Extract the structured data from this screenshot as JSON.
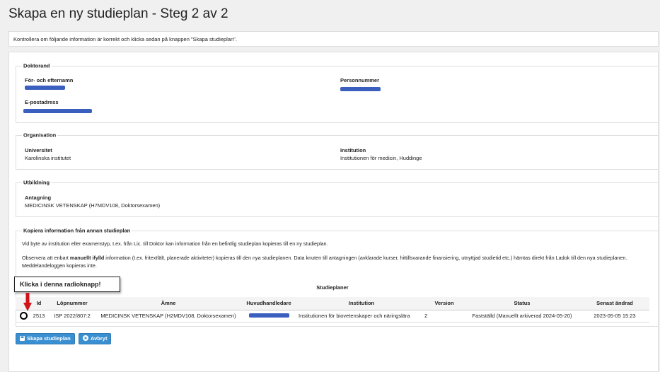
{
  "page": {
    "title": "Skapa en ny studieplan - Steg 2 av 2"
  },
  "notice": "Kontrollera om följande information är korrekt och klicka sedan på knappen \"Skapa studieplan\".",
  "doktorand": {
    "legend": "Doktorand",
    "name_label": "För- och efternamn",
    "pnr_label": "Personnummer",
    "email_label": "E-postadress"
  },
  "organisation": {
    "legend": "Organisation",
    "uni_label": "Universitet",
    "uni_value": "Karolinska institutet",
    "inst_label": "Institution",
    "inst_value": "Institutionen för medicin, Huddinge"
  },
  "utbildning": {
    "legend": "Utbildning",
    "antagning_label": "Antagning",
    "antagning_value": "MEDICINSK VETENSKAP (H7MDV108, Doktorsexamen)"
  },
  "kopiera": {
    "legend": "Kopiera information från annan studieplan",
    "para1": "Vid byte av institution eller examenstyp, t.ex. från Lic. till Doktor kan information från en befintlig studieplan kopieras till en ny studieplan.",
    "para2_pre": "Observera att enbart ",
    "para2_bold": "manuellt ifylld",
    "para2_post": " information (t.ex. fritextfält, planerade aktiviteter) kopieras till den nya studieplanen. Data knuten till antagningen (avklarade kurser, hittillsvarande finansiering, utnyttjad studietid etc.) hämtas direkt från Ladok till den nya studieplanen. Meddelandeloggen kopieras inte."
  },
  "table": {
    "caption": "Studieplaner",
    "headers": [
      "",
      "Id",
      "Löpnummer",
      "Ämne",
      "Huvudhandledare",
      "Institution",
      "Version",
      "Status",
      "Senast ändrad"
    ],
    "row": {
      "id": "2513",
      "lopnummer": "ISP 2022/807:2",
      "amne": "MEDICINSK VETENSKAP (H2MDV108, Doktorsexamen)",
      "institution": "Institutionen för biovetenskaper och näringslära",
      "version": "2",
      "status": "Fastställd (Manuellt arkiverad 2024-05-20)",
      "senast": "2023-05-05 15:23"
    }
  },
  "callout": "Klicka i denna radioknapp!",
  "buttons": {
    "create": "Skapa studieplan",
    "cancel": "Avbryt"
  },
  "colors": {
    "button": "#3a8fd1",
    "redaction": "#3a5fbf",
    "arrow": "#d0141a"
  }
}
